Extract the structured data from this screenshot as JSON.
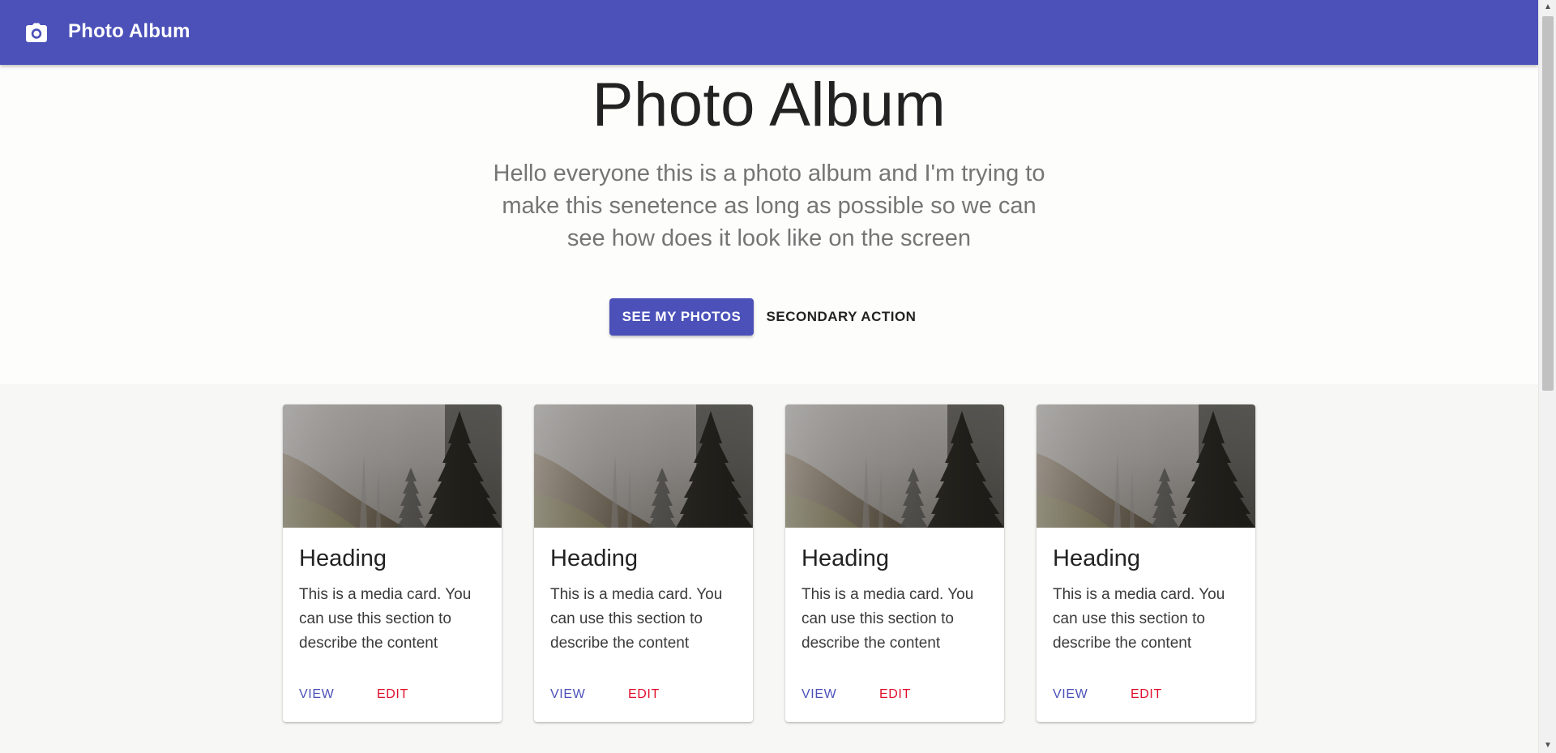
{
  "appbar": {
    "title": "Photo Album",
    "icon": "camera-icon"
  },
  "hero": {
    "title": "Photo Album",
    "subtitle": "Hello everyone this is a photo album and I'm trying to make this senetence as long as possible so we can see how does it look like on the screen",
    "primary_button": "SEE MY PHOTOS",
    "secondary_button": "SECONDARY ACTION"
  },
  "cards": [
    {
      "heading": "Heading",
      "text": "This is a media card. You can use this section to describe the content",
      "view_label": "VIEW",
      "edit_label": "EDIT"
    },
    {
      "heading": "Heading",
      "text": "This is a media card. You can use this section to describe the content",
      "view_label": "VIEW",
      "edit_label": "EDIT"
    },
    {
      "heading": "Heading",
      "text": "This is a media card. You can use this section to describe the content",
      "view_label": "VIEW",
      "edit_label": "EDIT"
    },
    {
      "heading": "Heading",
      "text": "This is a media card. You can use this section to describe the content",
      "view_label": "VIEW",
      "edit_label": "EDIT"
    }
  ],
  "colors": {
    "primary": "#4b51b9",
    "danger": "#e0102c",
    "page_bg": "#fdfdfb",
    "grid_bg": "#f7f7f5"
  }
}
